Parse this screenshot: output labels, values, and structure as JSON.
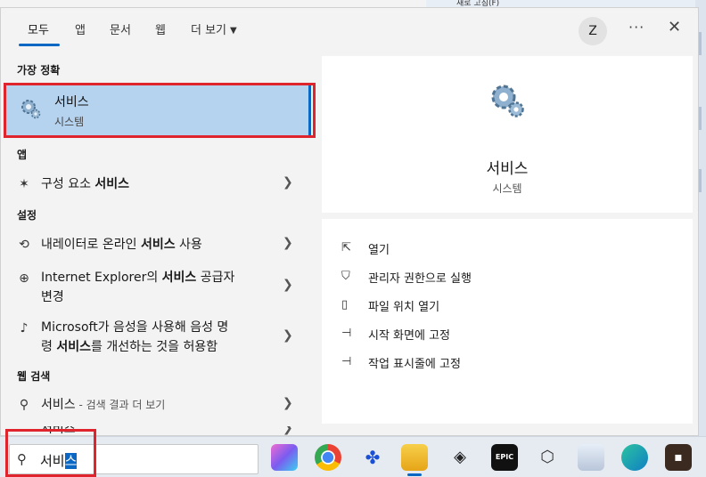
{
  "background": {
    "window_text": "새로 고침(F)"
  },
  "header": {
    "tabs": [
      {
        "label": "모두"
      },
      {
        "label": "앱"
      },
      {
        "label": "문서"
      },
      {
        "label": "웹"
      },
      {
        "label": "더 보기"
      }
    ],
    "avatar_letter": "Z",
    "more_symbol": "···",
    "close_symbol": "✕"
  },
  "left": {
    "best_match_label": "가장 정확",
    "best_match": {
      "title": "서비스",
      "subtitle": "시스템"
    },
    "apps_label": "앱",
    "app_item": {
      "pre": "구성 요소 ",
      "bold": "서비스"
    },
    "settings_label": "설정",
    "settings_items": [
      {
        "pre": "내레이터로 온라인 ",
        "bold": "서비스",
        "post": " 사용"
      },
      {
        "line1_pre": "Internet Explorer의 ",
        "line1_bold": "서비스",
        "line1_post": " 공급자",
        "line2": "변경"
      },
      {
        "line1": "Microsoft가 음성을 사용해 음성 명",
        "line2_pre": "령 ",
        "line2_bold": "서비스",
        "line2_post": "를 개선하는 것을 허용함"
      }
    ],
    "web_label": "웹 검색",
    "web_item": {
      "query": "서비스",
      "suffix": " - 검색 결과 더 보기"
    },
    "partial_item": "서비스"
  },
  "details": {
    "title": "서비스",
    "subtitle": "시스템",
    "actions": [
      {
        "label": "열기",
        "icon": "open-icon"
      },
      {
        "label": "관리자 권한으로 실행",
        "icon": "shield-icon"
      },
      {
        "label": "파일 위치 열기",
        "icon": "file-location-icon"
      },
      {
        "label": "시작 화면에 고정",
        "icon": "pin-icon"
      },
      {
        "label": "작업 표시줄에 고정",
        "icon": "pin-icon"
      }
    ]
  },
  "taskbar": {
    "search_text_plain": "서비",
    "search_text_selected": "스",
    "apps": [
      {
        "name": "copilot",
        "color": "#7b5cf0"
      },
      {
        "name": "chrome",
        "color": "#34a853"
      },
      {
        "name": "app-blue",
        "color": "#1a4fd6"
      },
      {
        "name": "file-explorer",
        "color": "#f2b932"
      },
      {
        "name": "app-dark",
        "color": "#222222"
      },
      {
        "name": "epic-games",
        "color": "#111111",
        "label": "EPIC"
      },
      {
        "name": "unity",
        "color": "#333333"
      },
      {
        "name": "app-image",
        "color": "#cfd8e8"
      },
      {
        "name": "edge",
        "color": "#0f7fc4"
      },
      {
        "name": "minecraft",
        "color": "#3b2a1f"
      }
    ]
  },
  "colors": {
    "accent": "#0a67c4",
    "highlight": "#b5d3ef",
    "annotation_red": "#e0242d"
  }
}
